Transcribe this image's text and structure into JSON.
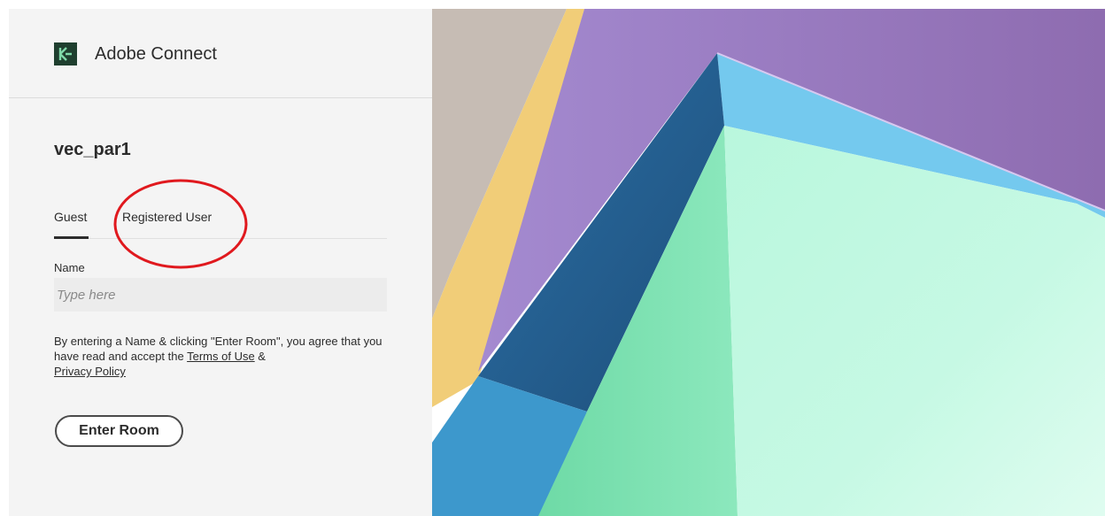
{
  "header": {
    "app_title": "Adobe Connect",
    "logo_icon": "adobe-connect-logo-icon"
  },
  "room": {
    "title": "vec_par1"
  },
  "tabs": [
    {
      "label": "Guest",
      "active": true
    },
    {
      "label": "Registered User",
      "active": false,
      "highlighted_by_red_circle": true
    }
  ],
  "form": {
    "name_label": "Name",
    "name_placeholder": "Type here",
    "name_value": ""
  },
  "consent": {
    "text_before": "By entering a Name & clicking \"Enter Room\", you agree that you have read and accept the ",
    "terms_link": "Terms of Use",
    "text_between": " & ",
    "privacy_link": "Privacy Policy"
  },
  "actions": {
    "enter_room_label": "Enter Room"
  },
  "colors": {
    "panel_bg": "#f4f4f4",
    "annotation_red": "#e0191e",
    "art_purple": "#9a80c2",
    "art_blue": "#74c9ee",
    "art_mint": "#a8f0d2",
    "art_yellow": "#f2cf76",
    "art_taupe": "#c8bdb4"
  }
}
